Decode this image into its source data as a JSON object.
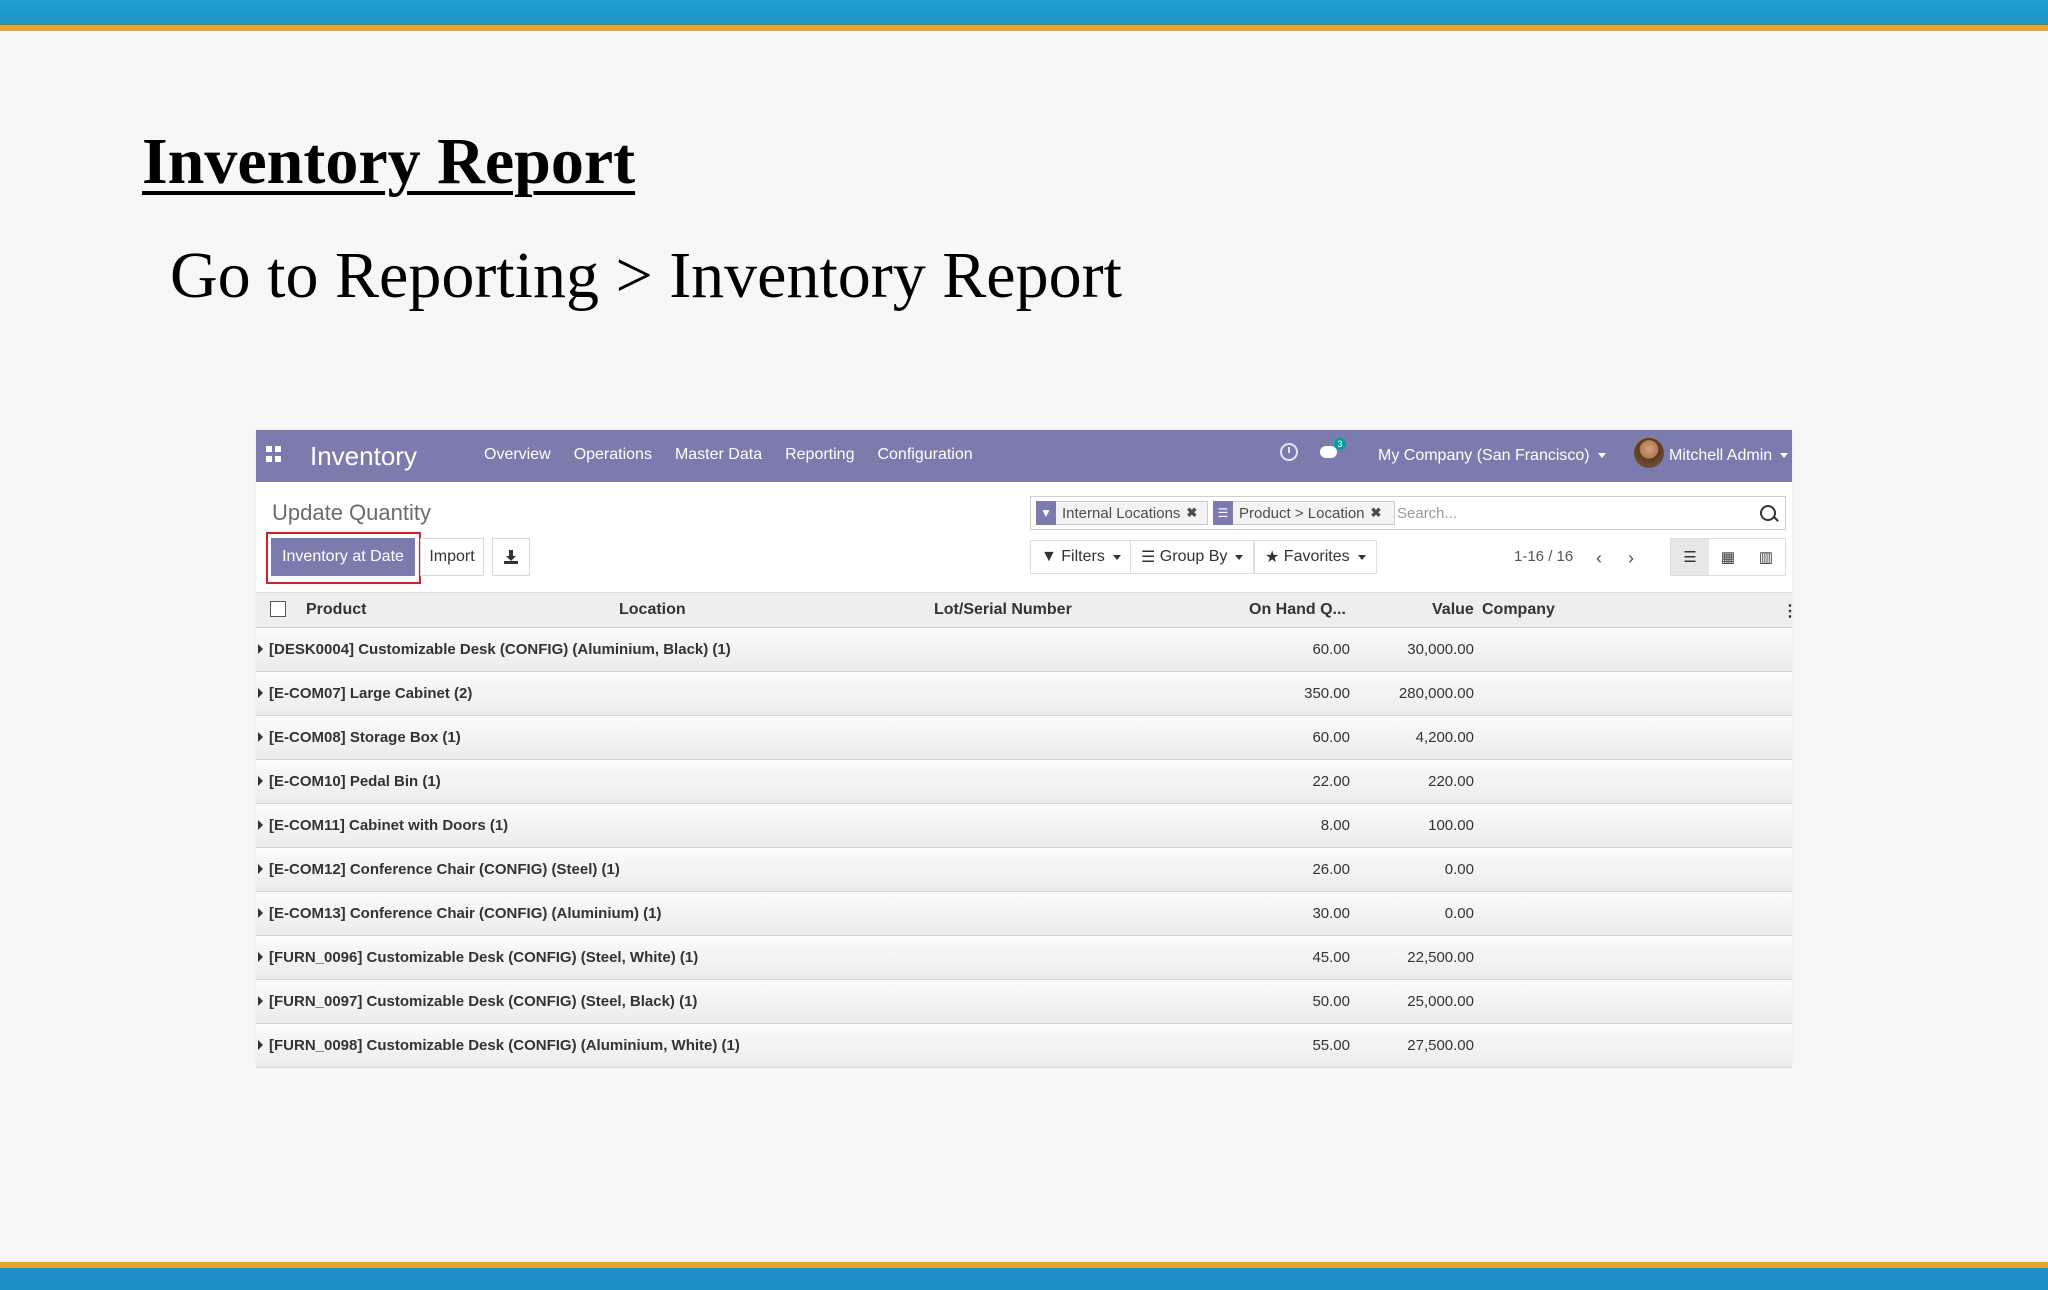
{
  "slide": {
    "title": "Inventory Report",
    "subtitle": "Go to Reporting > Inventory Report"
  },
  "navbar": {
    "app_name": "Inventory",
    "menu": [
      "Overview",
      "Operations",
      "Master Data",
      "Reporting",
      "Configuration"
    ],
    "chat_badge": "3",
    "company": "My Company (San Francisco)",
    "user": "Mitchell Admin"
  },
  "control_panel": {
    "title": "Update Quantity",
    "buttons": {
      "inventory_at_date": "Inventory at Date",
      "import": "Import"
    },
    "search": {
      "facets": [
        "Internal Locations",
        "Product > Location"
      ],
      "placeholder": "Search..."
    },
    "filters_label": "Filters",
    "group_by_label": "Group By",
    "favorites_label": "Favorites",
    "pager": "1-16 / 16"
  },
  "table": {
    "columns": {
      "product": "Product",
      "location": "Location",
      "lot": "Lot/Serial Number",
      "on_hand": "On Hand Q...",
      "value": "Value",
      "company": "Company"
    },
    "rows": [
      {
        "name": "[DESK0004] Customizable Desk (CONFIG) (Aluminium, Black) (1)",
        "on_hand": "60.00",
        "value": "30,000.00"
      },
      {
        "name": "[E-COM07] Large Cabinet (2)",
        "on_hand": "350.00",
        "value": "280,000.00"
      },
      {
        "name": "[E-COM08] Storage Box (1)",
        "on_hand": "60.00",
        "value": "4,200.00"
      },
      {
        "name": "[E-COM10] Pedal Bin (1)",
        "on_hand": "22.00",
        "value": "220.00"
      },
      {
        "name": "[E-COM11] Cabinet with Doors (1)",
        "on_hand": "8.00",
        "value": "100.00"
      },
      {
        "name": "[E-COM12] Conference Chair (CONFIG) (Steel) (1)",
        "on_hand": "26.00",
        "value": "0.00"
      },
      {
        "name": "[E-COM13] Conference Chair (CONFIG) (Aluminium) (1)",
        "on_hand": "30.00",
        "value": "0.00"
      },
      {
        "name": "[FURN_0096] Customizable Desk (CONFIG) (Steel, White) (1)",
        "on_hand": "45.00",
        "value": "22,500.00"
      },
      {
        "name": "[FURN_0097] Customizable Desk (CONFIG) (Steel, Black) (1)",
        "on_hand": "50.00",
        "value": "25,000.00"
      },
      {
        "name": "[FURN_0098] Customizable Desk (CONFIG) (Aluminium, White) (1)",
        "on_hand": "55.00",
        "value": "27,500.00"
      }
    ]
  },
  "colors": {
    "navbar": "#7c7bad",
    "highlight": "#d12026",
    "band_blue": "#1d8fc4",
    "band_orange": "#e8a52a"
  }
}
